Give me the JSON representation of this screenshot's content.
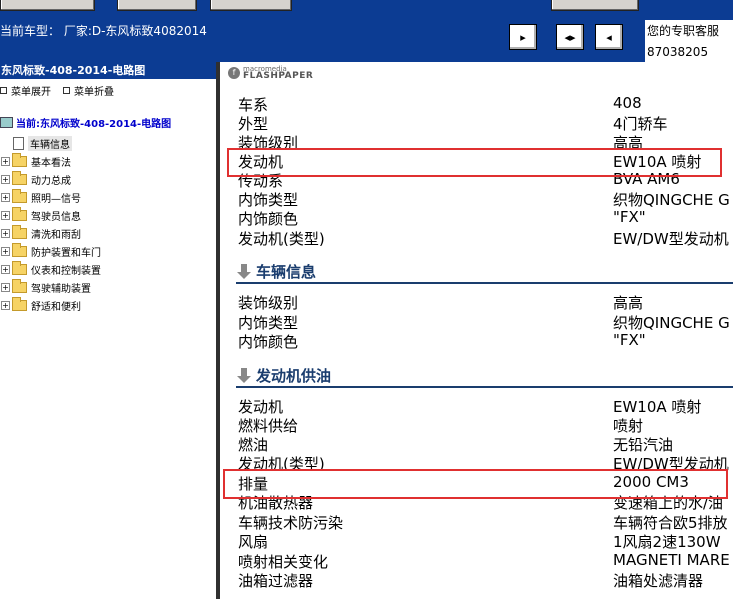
{
  "toolbar": {
    "car_type": "当前车型：  厂家:D-东风标致4082014"
  },
  "service": {
    "line1": "您的专职客服",
    "line2": "87038205"
  },
  "left_panel": {
    "title": "东风标致-408-2014-电路图",
    "menu_expand": "菜单展开",
    "menu_collapse": "菜单折叠",
    "root": "当前:东风标致-408-2014-电路图",
    "items": [
      {
        "label": "车辆信息"
      },
      {
        "label": "基本看法"
      },
      {
        "label": "动力总成"
      },
      {
        "label": "照明—信号"
      },
      {
        "label": "驾驶员信息"
      },
      {
        "label": "清洗和雨刮"
      },
      {
        "label": "防护装置和车门"
      },
      {
        "label": "仪表和控制装置"
      },
      {
        "label": "驾驶辅助装置"
      },
      {
        "label": "舒适和便利"
      }
    ]
  },
  "flashpaper": {
    "brand": "macromedia",
    "product": "FLASHPAPER"
  },
  "document": {
    "top_rows": [
      {
        "key": "车系",
        "value": "408"
      },
      {
        "key": "外型",
        "value": "4门轿车"
      },
      {
        "key": "装饰级别",
        "value": "高高"
      },
      {
        "key": "发动机",
        "value": "EW10A 喷射"
      },
      {
        "key": "传动系",
        "value": "BVA AM6"
      },
      {
        "key": "内饰类型",
        "value": "织物QINGCHE G"
      },
      {
        "key": "内饰颜色",
        "value": "\"FX\""
      },
      {
        "key": "发动机(类型)",
        "value": "EW/DW型发动机"
      }
    ],
    "section1": {
      "title": "车辆信息",
      "rows": [
        {
          "key": "装饰级别",
          "value": "高高"
        },
        {
          "key": "内饰类型",
          "value": "织物QINGCHE G"
        },
        {
          "key": "内饰颜色",
          "value": "\"FX\""
        }
      ]
    },
    "section2": {
      "title": "发动机供油",
      "rows": [
        {
          "key": "发动机",
          "value": "EW10A 喷射"
        },
        {
          "key": "燃料供给",
          "value": "喷射"
        },
        {
          "key": "燃油",
          "value": "无铅汽油"
        },
        {
          "key": "发动机(类型)",
          "value": "EW/DW型发动机"
        },
        {
          "key": "排量",
          "value": "2000 CM3"
        },
        {
          "key": "机油散热器",
          "value": "变速箱上的水/油"
        },
        {
          "key": "车辆技术防污染",
          "value": "车辆符合欧5排放"
        },
        {
          "key": "风扇",
          "value": "1风扇2速130W"
        },
        {
          "key": "喷射相关变化",
          "value": "MAGNETI MARE"
        },
        {
          "key": "油箱过滤器",
          "value": "油箱处滤清器"
        }
      ]
    }
  },
  "colors": {
    "header_bg": "#0c3c93",
    "highlight": "#e03030",
    "section_title": "#1a3d6e"
  }
}
